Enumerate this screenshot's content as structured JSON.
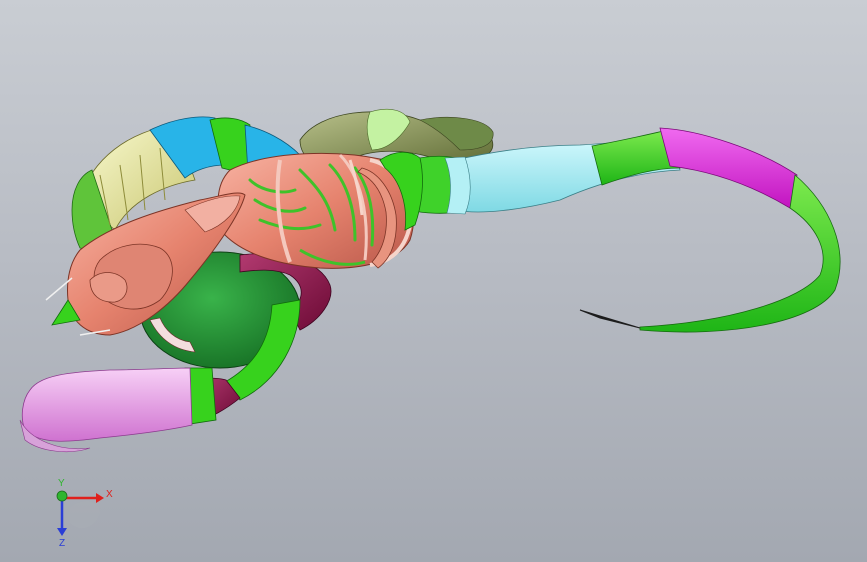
{
  "triad": {
    "x_label": "X",
    "y_label": "Y",
    "z_label": "Z",
    "x_color": "#e0201c",
    "y_color": "#2fb52f",
    "z_color": "#2a3ed6"
  },
  "model": {
    "part_colors": {
      "head": "#e08a78",
      "body_salmon": "#e8826e",
      "green": "#37d21d",
      "dark_green": "#229133",
      "yellow": "#ecea9a",
      "cyan": "#2cb4e6",
      "light_cyan": "#a8eef4",
      "olive": "#7d8a4c",
      "magenta": "#e223dc",
      "maroon": "#8a1246",
      "pink": "#e79ae6"
    }
  }
}
